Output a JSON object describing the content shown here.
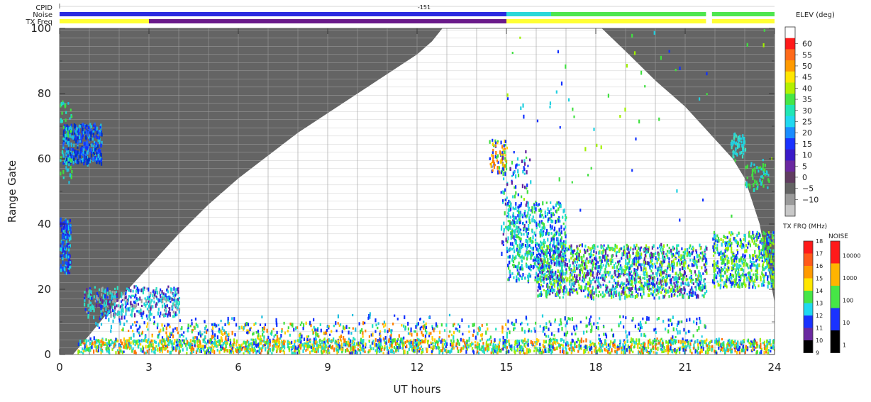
{
  "chart_data": {
    "type": "heatmap",
    "header": {
      "cpid_label": "CPID",
      "cpid_value": "-151",
      "noise_label": "Noise",
      "txfreq_label": "TX Freq",
      "noise_segments": [
        {
          "from": 0,
          "to": 15.0,
          "color": "#2a2ae0"
        },
        {
          "from": 15.0,
          "to": 16.5,
          "color": "#2ad8d8"
        },
        {
          "from": 16.5,
          "to": 21.7,
          "color": "#4ee64e"
        },
        {
          "from": 21.9,
          "to": 24.0,
          "color": "#4ee64e"
        }
      ],
      "txfreq_segments": [
        {
          "from": 0,
          "to": 3.0,
          "color": "#ffff33"
        },
        {
          "from": 3.0,
          "to": 15.0,
          "color": "#6a1a8a"
        },
        {
          "from": 15.0,
          "to": 21.7,
          "color": "#ffff33"
        },
        {
          "from": 21.9,
          "to": 24.0,
          "color": "#ffff33"
        }
      ]
    },
    "xlabel": "UT hours",
    "ylabel": "Range Gate",
    "xlim": [
      0,
      24
    ],
    "ylim": [
      0,
      100
    ],
    "x_ticks": [
      "0",
      "3",
      "6",
      "9",
      "12",
      "15",
      "18",
      "21",
      "24"
    ],
    "y_ticks": [
      "0",
      "20",
      "40",
      "60",
      "80",
      "100"
    ],
    "gs_color": "#646464",
    "gs_boundary_1": [
      [
        0.45,
        0
      ],
      [
        1.0,
        6
      ],
      [
        2.0,
        17
      ],
      [
        3.0,
        27
      ],
      [
        4.0,
        37
      ],
      [
        5.0,
        46
      ],
      [
        6.0,
        54
      ],
      [
        7.0,
        61
      ],
      [
        8.0,
        68
      ],
      [
        9.0,
        74
      ],
      [
        10.0,
        80
      ],
      [
        11.0,
        86
      ],
      [
        12.0,
        92
      ],
      [
        12.5,
        96
      ],
      [
        12.85,
        100
      ]
    ],
    "gs_boundary_2": [
      [
        18.2,
        100
      ],
      [
        19.0,
        93
      ],
      [
        20.0,
        84
      ],
      [
        21.0,
        76
      ],
      [
        22.0,
        66
      ],
      [
        22.6,
        60
      ],
      [
        23.0,
        54
      ],
      [
        23.5,
        40
      ],
      [
        24.0,
        16
      ]
    ],
    "scatter_blobs": [
      {
        "x": [
          0.0,
          0.35
        ],
        "y": [
          24,
          41
        ],
        "n": 160,
        "p": [
          "#2020e0",
          "#20d0e0",
          "#1050ff"
        ]
      },
      {
        "x": [
          0.1,
          1.4
        ],
        "y": [
          58,
          70
        ],
        "n": 360,
        "p": [
          "#1030ff",
          "#2060ff",
          "#20c0e0",
          "#0030c0"
        ]
      },
      {
        "x": [
          0.0,
          0.4
        ],
        "y": [
          52,
          77
        ],
        "n": 60,
        "p": [
          "#20e0c0",
          "#20c0e0",
          "#40e040"
        ]
      },
      {
        "x": [
          0.8,
          4.0
        ],
        "y": [
          11,
          20
        ],
        "n": 420,
        "p": [
          "#20d0e0",
          "#1030ff",
          "#30e0c0",
          "#a0a0a0",
          "#6020a0"
        ]
      },
      {
        "x": [
          0.6,
          24.0
        ],
        "y": [
          0,
          4
        ],
        "n": 1900,
        "p": [
          "#20d0e0",
          "#40e040",
          "#1030ff",
          "#a0f000",
          "#20e0c0",
          "#ffd000",
          "#ff7000"
        ]
      },
      {
        "x": [
          2.0,
          15.0
        ],
        "y": [
          3,
          9
        ],
        "n": 420,
        "p": [
          "#40e040",
          "#20e0c0",
          "#ff8000",
          "#1030ff",
          "#ffd000"
        ]
      },
      {
        "x": [
          14.4,
          15.0
        ],
        "y": [
          55,
          65
        ],
        "n": 80,
        "p": [
          "#ff8000",
          "#ffd000",
          "#1030ff",
          "#40e040"
        ]
      },
      {
        "x": [
          14.8,
          15.8
        ],
        "y": [
          30,
          62
        ],
        "n": 140,
        "p": [
          "#1030ff",
          "#20d0e0",
          "#40e040",
          "#6020a0"
        ]
      },
      {
        "x": [
          15.0,
          17.0
        ],
        "y": [
          22,
          46
        ],
        "n": 520,
        "p": [
          "#20d0e0",
          "#40e040",
          "#1030ff",
          "#20e0c0"
        ]
      },
      {
        "x": [
          16.0,
          21.7
        ],
        "y": [
          17,
          33
        ],
        "n": 1500,
        "p": [
          "#40e040",
          "#20d0e0",
          "#a0f000",
          "#1030ff",
          "#20e0c0",
          "#6020a0"
        ]
      },
      {
        "x": [
          21.9,
          24.0
        ],
        "y": [
          20,
          37
        ],
        "n": 560,
        "p": [
          "#20d0e0",
          "#40e040",
          "#1030ff",
          "#a0f000"
        ]
      },
      {
        "x": [
          22.5,
          23.0
        ],
        "y": [
          60,
          67
        ],
        "n": 60,
        "p": [
          "#20d0e0",
          "#40e0c0"
        ]
      },
      {
        "x": [
          23.0,
          23.8
        ],
        "y": [
          50,
          58
        ],
        "n": 60,
        "p": [
          "#40e040",
          "#20d0e0"
        ]
      },
      {
        "x": [
          15.0,
          21.7
        ],
        "y": [
          5,
          11
        ],
        "n": 160,
        "p": [
          "#1030ff",
          "#20d0e0",
          "#40e040"
        ]
      },
      {
        "x": [
          1.0,
          14.0
        ],
        "y": [
          4,
          12
        ],
        "n": 120,
        "p": [
          "#1030ff",
          "#20c0e0"
        ]
      },
      {
        "x": [
          15.0,
          24.0
        ],
        "y": [
          40,
          100
        ],
        "n": 60,
        "p": [
          "#1030ff",
          "#40e040",
          "#20d0e0",
          "#a0f000"
        ]
      }
    ],
    "elev_colorbar": {
      "title": "ELEV (deg)",
      "labels": [
        "60",
        "55",
        "50",
        "45",
        "40",
        "35",
        "30",
        "25",
        "20",
        "15",
        "10",
        "5",
        "0",
        "−5",
        "−10"
      ],
      "colors": [
        "#ffffff",
        "#ff1a1a",
        "#ff6a1a",
        "#ff9a00",
        "#ffe600",
        "#b4f000",
        "#46e646",
        "#20e6b4",
        "#20d8f0",
        "#1a8cff",
        "#1a32ff",
        "#3a1ac8",
        "#6a28a0",
        "#603c60",
        "#646464",
        "#9a9a9a",
        "#c8c8c8"
      ]
    },
    "txfrq_colorbar": {
      "title": "TX FRQ (MHz)",
      "labels": [
        "18",
        "17",
        "16",
        "15",
        "14",
        "13",
        "12",
        "11",
        "10",
        "9"
      ],
      "colors": [
        "#ff1a1a",
        "#ff5a1a",
        "#ff9a00",
        "#ffe600",
        "#46e646",
        "#20d8f0",
        "#1a32ff",
        "#6a28a0",
        "#000000"
      ]
    },
    "noise_colorbar": {
      "title": "NOISE",
      "labels": [
        "10000",
        "1000",
        "100",
        "10",
        "1"
      ],
      "colors": [
        "#ff1a1a",
        "#ffb400",
        "#46e646",
        "#1a32ff",
        "#000000"
      ]
    }
  }
}
